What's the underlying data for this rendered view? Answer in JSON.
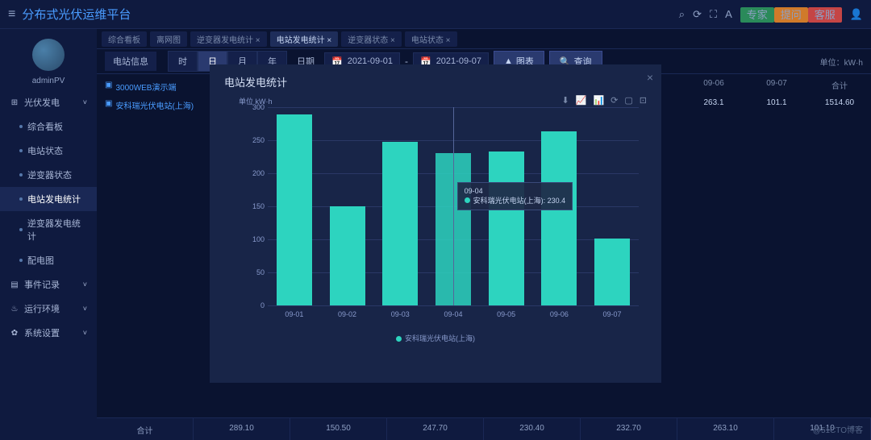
{
  "app_title": "分布式光伏运维平台",
  "user_name": "adminPV",
  "top_tags": [
    {
      "label": "专家",
      "color": "#2a8a5a"
    },
    {
      "label": "提问",
      "color": "#d07a2a"
    },
    {
      "label": "客服",
      "color": "#c54545"
    }
  ],
  "sidebar": {
    "groups": [
      {
        "icon": "⊞",
        "label": "光伏发电",
        "chev": "˅",
        "items": [
          {
            "label": "综合看板"
          },
          {
            "label": "电站状态"
          },
          {
            "label": "逆变器状态"
          },
          {
            "label": "电站发电统计",
            "active": true
          },
          {
            "label": "逆变器发电统计"
          },
          {
            "label": "配电图"
          }
        ]
      },
      {
        "icon": "▤",
        "label": "事件记录",
        "chev": "˅"
      },
      {
        "icon": "♨",
        "label": "运行环境",
        "chev": "˅"
      },
      {
        "icon": "✿",
        "label": "系统设置",
        "chev": "˅"
      }
    ]
  },
  "tabs": [
    "综合看板",
    "离网图",
    "逆变器发电统计 ×",
    "电站发电统计 ×",
    "逆变器状态 ×",
    "电站状态 ×"
  ],
  "active_tab": 3,
  "info_label": "电站信息",
  "stations": [
    "3000WEB演示端",
    "安科瑞光伏电站(上海)"
  ],
  "seg": {
    "items": [
      "时",
      "日",
      "月",
      "年"
    ],
    "active": 1
  },
  "date": {
    "label": "日期",
    "from": "2021-09-01",
    "to": "2021-09-07"
  },
  "buttons": {
    "chart": "图表",
    "query": "查询"
  },
  "unit": "单位：kW·h",
  "header_cols": [
    "09-06",
    "09-07",
    "合计"
  ],
  "row_vals": [
    "263.1",
    "101.1",
    "1514.60"
  ],
  "bottom_row": [
    "合计",
    "289.10",
    "150.50",
    "247.70",
    "230.40",
    "232.70",
    "263.10",
    "101.10"
  ],
  "watermark": "@51CTO博客",
  "modal": {
    "title": "电站发电统计",
    "y_unit": "单位 kW·h",
    "legend": "安科瑞光伏电站(上海)"
  },
  "tooltip": {
    "date": "09-04",
    "series": "安科瑞光伏电站(上海)",
    "value": "230.4"
  },
  "chart_data": {
    "type": "bar",
    "categories": [
      "09-01",
      "09-02",
      "09-03",
      "09-04",
      "09-05",
      "09-06",
      "09-07"
    ],
    "series": [
      {
        "name": "安科瑞光伏电站(上海)",
        "values": [
          289.1,
          150.5,
          247.7,
          230.4,
          232.7,
          263.1,
          101.1
        ]
      }
    ],
    "ylabel": "单位 kW·h",
    "ylim": [
      0,
      300
    ],
    "yticks": [
      0,
      50,
      100,
      150,
      200,
      250,
      300
    ]
  }
}
